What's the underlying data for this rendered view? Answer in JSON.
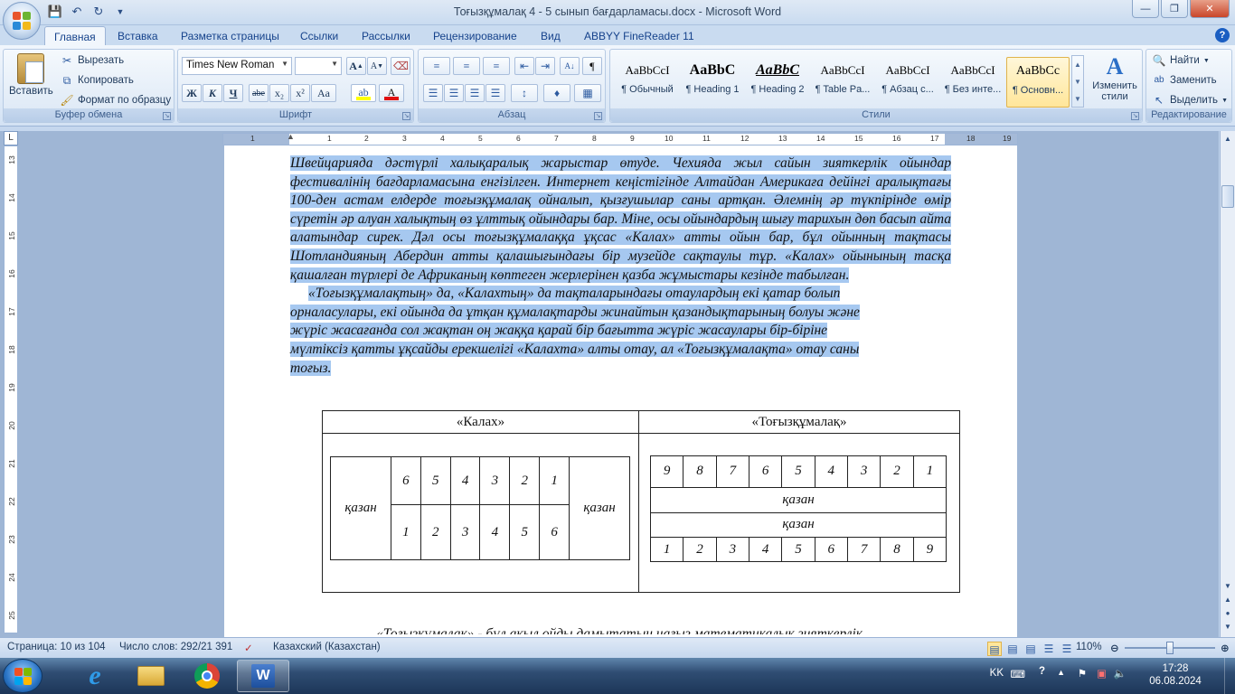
{
  "window": {
    "title": "Тоғызқұмалақ  4 - 5 сынып бағдарламасы.docx - Microsoft Word"
  },
  "tabs": [
    "Главная",
    "Вставка",
    "Разметка страницы",
    "Ссылки",
    "Рассылки",
    "Рецензирование",
    "Вид",
    "ABBYY FineReader 11"
  ],
  "active_tab": "Главная",
  "ribbon": {
    "clipboard": {
      "label": "Буфер обмена",
      "paste": "Вставить",
      "cut": "Вырезать",
      "copy": "Копировать",
      "format_painter": "Формат по образцу"
    },
    "font": {
      "label": "Шрифт",
      "font_name": "Times New Roman",
      "font_size": "",
      "bold": "Ж",
      "italic": "К",
      "underline": "Ч",
      "strike": "abe",
      "subscript": "x₂",
      "superscript": "x²",
      "case": "Aa",
      "grow": "A",
      "shrink": "A"
    },
    "paragraph": {
      "label": "Абзац"
    },
    "styles": {
      "label": "Стили",
      "items": [
        {
          "sample": "AaBbCcI",
          "name": "¶ Обычный"
        },
        {
          "sample": "AaBbC",
          "name": "¶ Heading 1"
        },
        {
          "sample": "AaBbC",
          "name": "¶ Heading 2"
        },
        {
          "sample": "AaBbCcI",
          "name": "¶ Table Pa..."
        },
        {
          "sample": "AaBbCcI",
          "name": "¶ Абзац с..."
        },
        {
          "sample": "AaBbCcI",
          "name": "¶ Без инте..."
        },
        {
          "sample": "AaBbCc",
          "name": "¶ Основн..."
        }
      ],
      "change_styles": "Изменить стили"
    },
    "editing": {
      "label": "Редактирование",
      "find": "Найти",
      "replace": "Заменить",
      "select": "Выделить"
    }
  },
  "ruler": {
    "h_numbers": [
      "1",
      "1",
      "2",
      "3",
      "4",
      "5",
      "6",
      "7",
      "8",
      "9",
      "10",
      "11",
      "12",
      "13",
      "14",
      "15",
      "16",
      "17",
      "18",
      "19"
    ],
    "v_numbers": [
      "13",
      "14",
      "15",
      "16",
      "17",
      "18",
      "19",
      "20",
      "21",
      "22",
      "23",
      "24",
      "25"
    ]
  },
  "document": {
    "paragraph1": "Швейцарияда дәстүрлі халықаралық жарыстар өтуде. Чехияда жыл сайын зияткерлік ойындар фестивалінің бағдарламасына енгізілген. Интернет кеңістігінде Алтайдан Америкаға дейінгі аралықтағы 100-ден астам елдерде тоғызқұмалақ ойналып, қызғушылар саны артқан. Әлемнің әр түкпірінде өмір сүретін әр алуан халықтың өз ұлттық ойындары бар. Міне, осы ойындардың шығу тарихын дөп басып айта алатындар сирек. Дәл осы тоғызқұмалаққа ұқсас «Калах» атты ойын бар, бұл ойынның тақтасы Шотландияның Абердин атты қалашығындағы бір музейде сақтаулы тұр. «Калах» ойынының тасқа қашалған түрлері де Африканың көптеген жерлерінен қазба жұмыстары кезінде табылған.",
    "paragraph2_lines": [
      "«Тоғызқұмалақтың» да, «Калахтың» да тақталарындағы отаулардың екі қатар болып",
      "орналасулары, екі ойында да ұтқан құмалақтарды жинайтын қазандықтарының болуы және",
      "жүріс жасағанда сол жақтан оң жаққа қарай бір бағытта жүріс жасаулары бір-біріне",
      "мүлтіксіз қатты ұқсайды ерекшелігі  «Калахта» алты отау, ал «Тоғызқұмалақта» отау саны",
      "тоғыз."
    ],
    "table": {
      "header_left": "«Калах»",
      "header_right": "«Тоғызқұмалақ»",
      "kalah": {
        "kazan_left": "қазан",
        "kazan_right": "қазан",
        "top_row": [
          "6",
          "5",
          "4",
          "3",
          "2",
          "1"
        ],
        "bottom_row": [
          "1",
          "2",
          "3",
          "4",
          "5",
          "6"
        ]
      },
      "togyz": {
        "top_row": [
          "9",
          "8",
          "7",
          "6",
          "5",
          "4",
          "3",
          "2",
          "1"
        ],
        "kazan1": "қазан",
        "kazan2": "қазан",
        "bottom_row": [
          "1",
          "2",
          "3",
          "4",
          "5",
          "6",
          "7",
          "8",
          "9"
        ]
      }
    },
    "bottom_line": "«Тоғызқұмалақ» - бұл ақыл ойды дамытатын нағыз математикалық зияткерлік"
  },
  "statusbar": {
    "page": "Страница: 10 из 104",
    "words": "Число слов: 292/21 391",
    "language": "Казахский (Казахстан)",
    "zoom": "110%"
  },
  "tray": {
    "lang": "KK",
    "time": "17:28",
    "date": "06.08.2024"
  },
  "colors": {
    "selection": "#a6c8f0",
    "ribbon_bg": "#dde9f7",
    "accent": "#15428b"
  }
}
